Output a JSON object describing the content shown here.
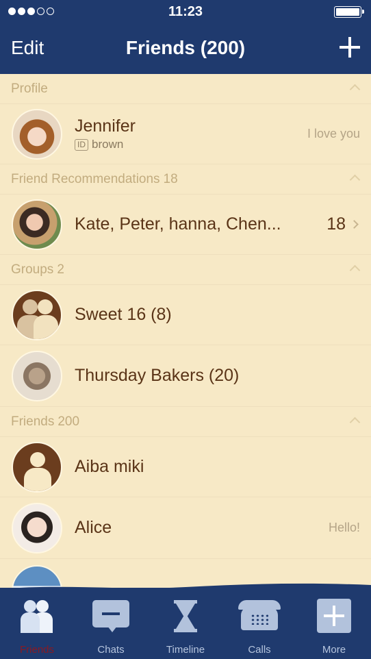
{
  "status_bar": {
    "time": "11:23",
    "signal_filled": 3,
    "signal_total": 5
  },
  "nav": {
    "edit_label": "Edit",
    "title": "Friends (200)"
  },
  "sections": {
    "profile": {
      "title": "Profile"
    },
    "recommendations": {
      "title": "Friend Recommendations",
      "count": "18"
    },
    "groups": {
      "title": "Groups",
      "count": "2"
    },
    "friends": {
      "title": "Friends",
      "count": "200"
    }
  },
  "profile": {
    "name": "Jennifer",
    "id_badge": "ID",
    "id_value": "brown",
    "status": "I love you"
  },
  "recommendations": {
    "names": "Kate, Peter, hanna, Chen...",
    "count": "18"
  },
  "groups": [
    {
      "name": "Sweet 16 (8)"
    },
    {
      "name": "Thursday Bakers (20)"
    }
  ],
  "friends": [
    {
      "name": "Aiba miki",
      "status": ""
    },
    {
      "name": "Alice",
      "status": "Hello!"
    }
  ],
  "tabs": [
    {
      "label": "Friends",
      "icon": "friends-icon",
      "active": true
    },
    {
      "label": "Chats",
      "icon": "chat-bubble-icon",
      "active": false
    },
    {
      "label": "Timeline",
      "icon": "hourglass-icon",
      "active": false
    },
    {
      "label": "Calls",
      "icon": "telephone-icon",
      "active": false
    },
    {
      "label": "More",
      "icon": "plus-box-icon",
      "active": false
    }
  ],
  "colors": {
    "nav_bg": "#1f3a6e",
    "list_bg": "#f7e9c6",
    "text_brown": "#5a3417",
    "active_tab": "#8a1a22"
  }
}
